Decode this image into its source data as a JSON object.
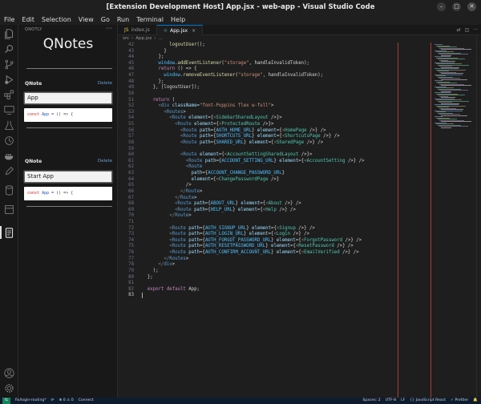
{
  "window": {
    "title": "[Extension Development Host] App.jsx - web-app - Visual Studio Code",
    "controls": [
      "–",
      "□",
      "✕"
    ]
  },
  "menu": [
    "File",
    "Edit",
    "Selection",
    "View",
    "Go",
    "Run",
    "Terminal",
    "Help"
  ],
  "activity_bar": {
    "icons": [
      "files-icon",
      "search-icon",
      "source-control-icon",
      "run-debug-icon",
      "extensions-icon",
      "remote-explorer-icon",
      "testing-icon",
      "docker-icon",
      "timeline-icon",
      "database-icon",
      "qnotes-icon"
    ],
    "bottom_icons": [
      "account-icon",
      "settings-gear-icon"
    ]
  },
  "sidebar": {
    "header": "QNOTLY",
    "more": "···",
    "app_title": "QNotes",
    "notes": [
      {
        "label": "QNote",
        "delete": "Delete",
        "input": "App",
        "code_kw": "const",
        "code_name": "App",
        "code_rest": " = () => {"
      },
      {
        "label": "QNote",
        "delete": "Delete",
        "input": "Start App",
        "code_kw": "const",
        "code_name": "App",
        "code_rest": " = () => {"
      }
    ]
  },
  "tabs": [
    {
      "icon": "JS",
      "label": "index.js",
      "active": false
    },
    {
      "icon": "⚛",
      "label": "App.jsx",
      "active": true,
      "close": "×"
    }
  ],
  "breadcrumb": [
    "src",
    "›",
    "App.jsx",
    "›",
    "..."
  ],
  "editor": {
    "current_line": 83,
    "lines": [
      {
        "n": "42",
        "t": "          logoutUser();"
      },
      {
        "n": "43",
        "t": "        }"
      },
      {
        "n": "44",
        "t": "      };"
      },
      {
        "n": "45",
        "t": "      window.addEventListener(\"storage\", handleInvalidToken);"
      },
      {
        "n": "46",
        "t": "      return () => {"
      },
      {
        "n": "47",
        "t": "        window.removeEventListener(\"storage\", handleInvalidToken);"
      },
      {
        "n": "48",
        "t": "      };"
      },
      {
        "n": "49",
        "t": "    }, [logoutUser]);"
      },
      {
        "n": "50",
        "t": ""
      },
      {
        "n": "51",
        "t": "    return ("
      },
      {
        "n": "52",
        "t": "      <div className=\"font-Poppins flex w-full\">"
      },
      {
        "n": "53",
        "t": "        <Routes>"
      },
      {
        "n": "54",
        "t": "          <Route element={<SidebarSharedLayout />}>"
      },
      {
        "n": "55",
        "t": "            <Route element={<ProtectedRoute />}>"
      },
      {
        "n": "56",
        "t": "              <Route path={AUTH_HOME_URL} element={<HomePage />} />"
      },
      {
        "n": "57",
        "t": "              <Route path={SHORTCUTS_URL} element={<ShortcutsPage />} />"
      },
      {
        "n": "58",
        "t": "              <Route path={SHARED_URL} element={<SharedPage />} />"
      },
      {
        "n": "59",
        "t": ""
      },
      {
        "n": "60",
        "t": "              <Route element={<AccountSettingSharedLayout />}>"
      },
      {
        "n": "61",
        "t": "                <Route path={ACCOUNT_SETTING_URL} element={<AccountSetting />} />"
      },
      {
        "n": "62",
        "t": "                <Route"
      },
      {
        "n": "63",
        "t": "                  path={ACCOUNT_CHANGE_PASSWORD_URL}"
      },
      {
        "n": "64",
        "t": "                  element={<ChangePasswordPage />}"
      },
      {
        "n": "65",
        "t": "                />"
      },
      {
        "n": "66",
        "t": "              </Route>"
      },
      {
        "n": "67",
        "t": "            </Route>"
      },
      {
        "n": "68",
        "t": "            <Route path={ABOUT_URL} element={<About />} />"
      },
      {
        "n": "69",
        "t": "            <Route path={HELP_URL} element={<Help />} />"
      },
      {
        "n": "70",
        "t": "          </Route>"
      },
      {
        "n": "71",
        "t": ""
      },
      {
        "n": "72",
        "t": "          <Route path={AUTH_SIGNUP_URL} element={<Signup />} />"
      },
      {
        "n": "73",
        "t": "          <Route path={AUTH_LOGIN_URL} element={<Login />} />"
      },
      {
        "n": "74",
        "t": "          <Route path={AUTH_FORGOT_PASSWORD_URL} element={<ForgotPassword />} />"
      },
      {
        "n": "75",
        "t": "          <Route path={AUTH_RESETPASSWORD_URL} element={<ResetPassword />} />"
      },
      {
        "n": "76",
        "t": "          <Route path={AUTH_CONFIRM_ACCOUNT_URL} element={<EmailVerified />} />"
      },
      {
        "n": "77",
        "t": "        </Routes>"
      },
      {
        "n": "78",
        "t": "      </div>"
      },
      {
        "n": "79",
        "t": "    );"
      },
      {
        "n": "80",
        "t": "  };"
      },
      {
        "n": "81",
        "t": ""
      },
      {
        "n": "82",
        "t": "  export default App;"
      },
      {
        "n": "83",
        "t": ""
      }
    ]
  },
  "status": {
    "branch": "fix/login-routing*",
    "sync": "⟳",
    "problems": "⊗ 0 ⚠ 0",
    "connect": "Connect",
    "right": [
      "Spaces: 2",
      "UTF-8",
      "LF",
      "{} JavaScript React",
      "✓ Prettier",
      "🔔"
    ]
  },
  "colors": {
    "accent": "#0078d4",
    "ruler_red": "#c0392b",
    "status_bg": "#0f1c2e"
  }
}
